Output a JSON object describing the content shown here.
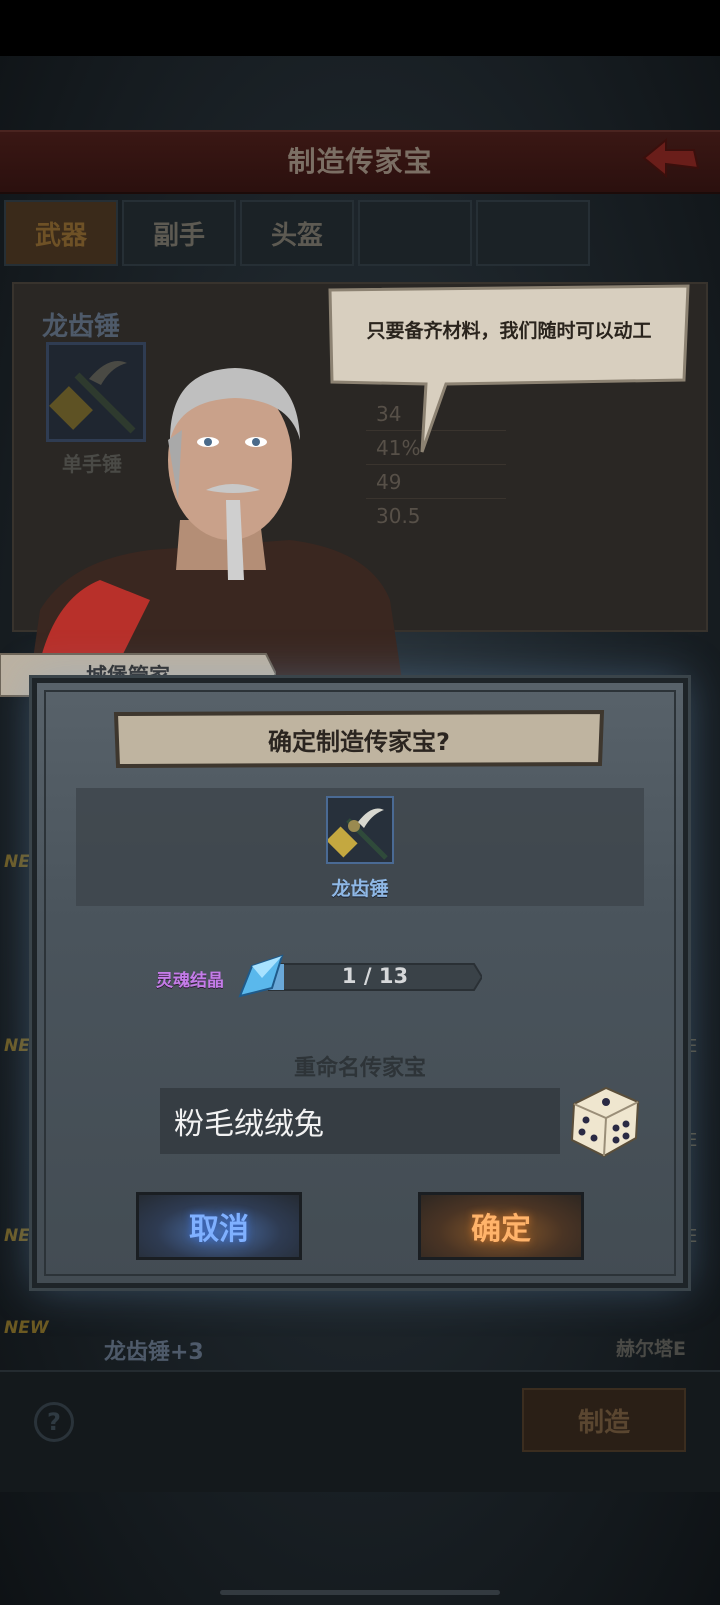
{
  "header": {
    "title": "制造传家宝"
  },
  "tabs": [
    "武器",
    "副手",
    "头盔",
    "",
    ""
  ],
  "weapon_panel": {
    "name": "龙齿锤",
    "type": "单手锤",
    "stats": [
      "34",
      "41%",
      "49",
      "30.5"
    ]
  },
  "list": {
    "new_tag": "NEW",
    "last_item_name": "龙齿锤+3",
    "last_item_owner": "赫尔塔E",
    "side_letter": "E"
  },
  "footer": {
    "help": "?",
    "make_button": "制造"
  },
  "npc": {
    "speech": "只要备齐材料，我们随时可以动工",
    "name": "城堡管家"
  },
  "dialog": {
    "title": "确定制造传家宝?",
    "item_name": "龙齿锤",
    "material_label": "灵魂结晶",
    "material_progress": "1 / 13",
    "material_have": 1,
    "material_need": 13,
    "rename_label": "重命名传家宝",
    "name_value": "粉毛绒绒兔",
    "cancel_label": "取消",
    "confirm_label": "确定"
  },
  "colors": {
    "cancel_glow": "#7fb0ff",
    "confirm_glow": "#ffb36a",
    "material_label": "#c47ce8",
    "item_name": "#8fb8e6"
  }
}
